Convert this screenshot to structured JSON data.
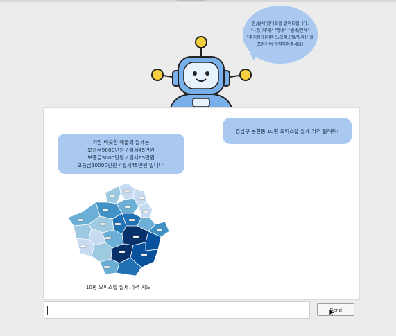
{
  "robot_bubble": {
    "lines": [
      "전/월세 임대료를 알려드립니다.",
      "\"~동(지역)\" \"평수\" \"월세/전세\"",
      "\"주거형태(아파트/오피스텔/빌라)\" 를",
      "포함하여 입력하여주세요!"
    ]
  },
  "chat": {
    "user_message": "강남구 논현동 10평 오피스텔 월세 가격 알려줘!",
    "bot_lines": [
      "가장 비슷한 매물의 월세는",
      "보증금9000만원 / 월세45만원",
      "보증금3000만원 / 월세65만원",
      "보증금10000만원 / 월세45만원 입니다."
    ],
    "map_caption": "10평 오피스텔 월세 가격 지도"
  },
  "input": {
    "value": ""
  },
  "send_button": {
    "label": "Send"
  },
  "colors": {
    "bubble": "#a9c9f1",
    "map_dark": "#08306b",
    "map_light": "#c6dbef"
  }
}
